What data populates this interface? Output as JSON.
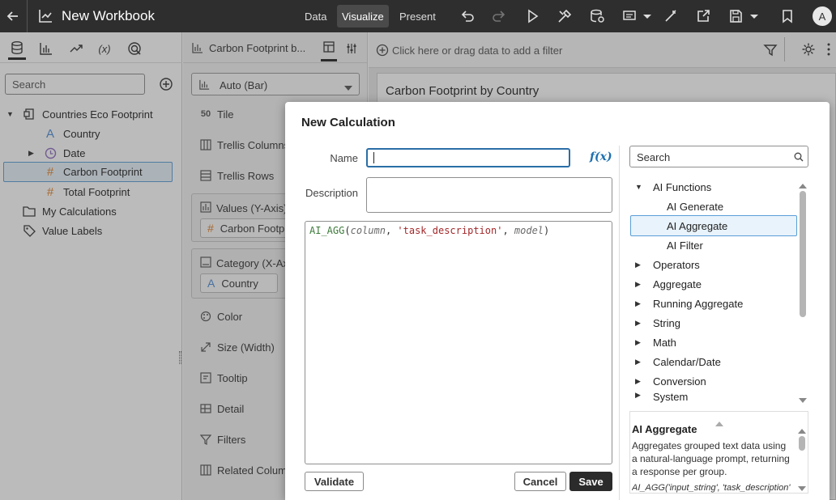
{
  "topbar": {
    "title": "New Workbook",
    "tabs": [
      "Data",
      "Visualize",
      "Present"
    ],
    "avatar_letter": "A"
  },
  "left_panel": {
    "search_placeholder": "Search",
    "tree": {
      "source": "Countries Eco Footprint",
      "items": [
        {
          "label": "Country",
          "icon": "A"
        },
        {
          "label": "Date",
          "icon": "clock"
        },
        {
          "label": "Carbon Footprint",
          "icon": "#"
        },
        {
          "label": "Total Footprint",
          "icon": "#"
        }
      ],
      "my_calculations": "My Calculations",
      "value_labels": "Value Labels"
    }
  },
  "middle_panel": {
    "viz_title": "Carbon Footprint b...",
    "chart_type": "Auto (Bar)",
    "rows": [
      {
        "label": "Tile",
        "icon": "50"
      },
      {
        "label": "Trellis Columns",
        "icon": "cols"
      },
      {
        "label": "Trellis Rows",
        "icon": "rows"
      }
    ],
    "values_section": {
      "label": "Values (Y-Axis)",
      "pill": "Carbon Footpr"
    },
    "category_section": {
      "label": "Category (X-Ax",
      "pill": "Country"
    },
    "lower_rows": [
      {
        "label": "Color",
        "icon": "palette"
      },
      {
        "label": "Size (Width)",
        "icon": "size"
      },
      {
        "label": "Tooltip",
        "icon": "tooltip"
      },
      {
        "label": "Detail",
        "icon": "detail"
      },
      {
        "label": "Filters",
        "icon": "filter"
      },
      {
        "label": "Related Columns",
        "icon": "related"
      }
    ]
  },
  "canvas": {
    "filter_placeholder": "Click here or drag data to add a filter",
    "viz_title": "Carbon Footprint by Country"
  },
  "dialog": {
    "title": "New Calculation",
    "name_label": "Name",
    "name_value": "",
    "description_label": "Description",
    "description_value": "",
    "expression": {
      "fn": "AI_AGG",
      "open": "(",
      "arg1": "column",
      "sep1": ", ",
      "arg2": "'task_description'",
      "sep2": ", ",
      "arg3": "model",
      "close": ")"
    },
    "validate_label": "Validate",
    "cancel_label": "Cancel",
    "save_label": "Save",
    "fx_label": "f(x)",
    "functions_search_placeholder": "Search",
    "function_tree": {
      "group": "AI Functions",
      "ai_items": [
        "AI Generate",
        "AI Aggregate",
        "AI Filter"
      ],
      "categories": [
        "Operators",
        "Aggregate",
        "Running Aggregate",
        "String",
        "Math",
        "Calendar/Date",
        "Conversion",
        "System"
      ]
    },
    "help": {
      "title": "AI Aggregate",
      "body": "Aggregates grouped text data using a natural-language prompt, returning a response per group.",
      "syntax": "AI_AGG('input_string', 'task_description'"
    }
  },
  "colors": {
    "topbar": "#2e2e2e",
    "accent": "#1d6fb0",
    "selection_bg": "#e8f3fb",
    "selection_border": "#5a9ed8",
    "number_icon": "#e0812c",
    "text_icon": "#4d8ed8",
    "date_icon": "#8e6fc1",
    "expr_fn": "#3d7a3a",
    "expr_string": "#a3282a",
    "expr_arg": "#6a6a6a"
  }
}
